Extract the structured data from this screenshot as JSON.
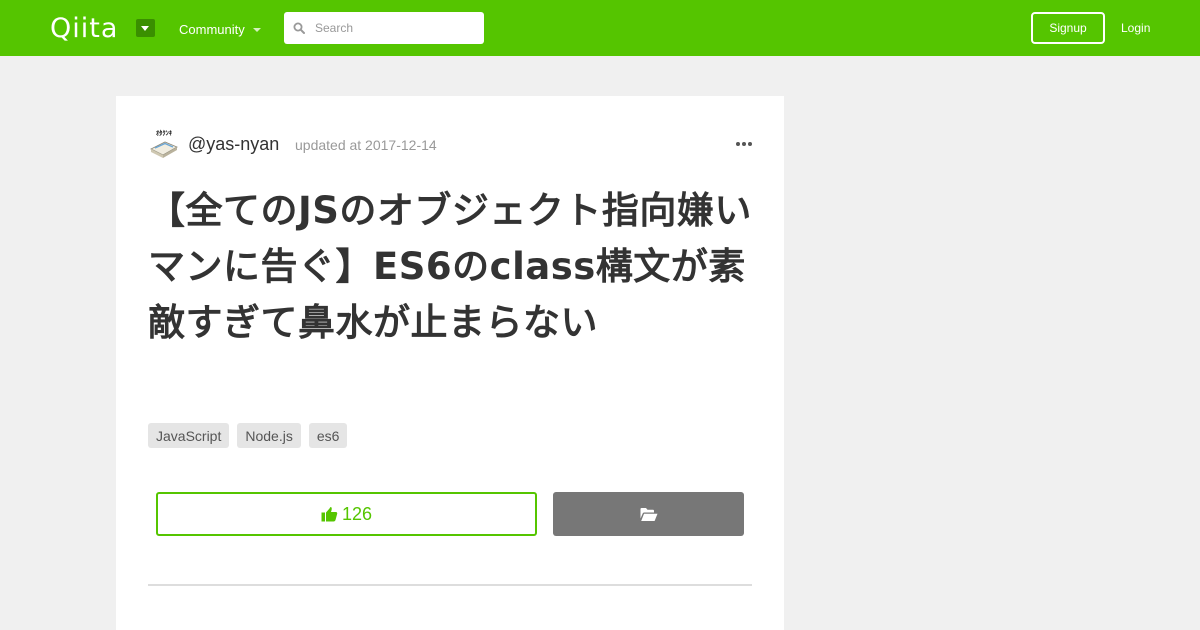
{
  "header": {
    "logo_text": "Qiita",
    "community_label": "Community",
    "search_placeholder": "Search",
    "signup_label": "Signup",
    "login_label": "Login",
    "brand_color": "#55c500"
  },
  "article": {
    "author": "@yas-nyan",
    "avatar_text": "ｵﾀｸﾝｷ",
    "updated": "updated at 2017-12-14",
    "title": "【全てのJSのオブジェクト指向嫌いマンに告ぐ】ES6のclass構文が素敵すぎて鼻水が止まらない",
    "tags": [
      "JavaScript",
      "Node.js",
      "es6"
    ],
    "likes": "126",
    "icons": {
      "like": "thumbs-up-icon",
      "stock": "folder-open-icon",
      "menu": "more-horizontal-icon"
    }
  }
}
